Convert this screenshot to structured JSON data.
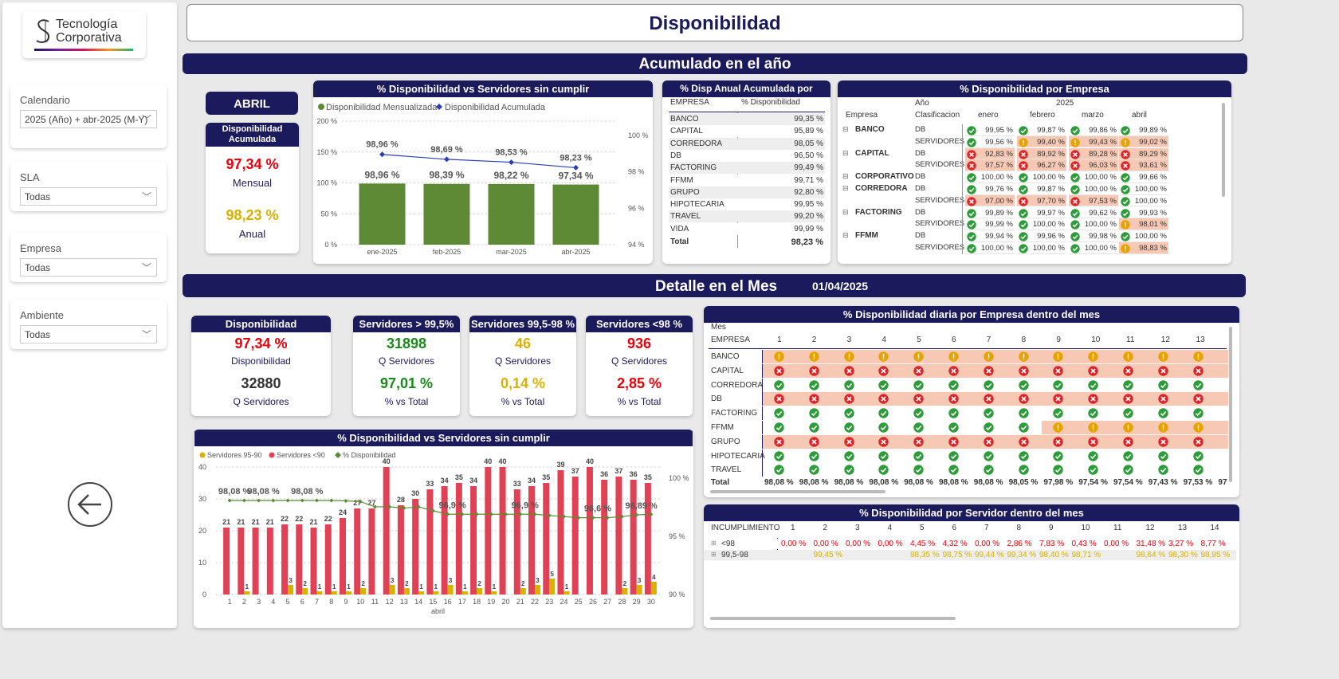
{
  "logo": {
    "line1": "Tecnología",
    "line2": "Corporativa"
  },
  "filters": [
    {
      "label": "Calendario",
      "value": "2025 (Año) + abr-2025 (M-Y)"
    },
    {
      "label": "SLA",
      "value": "Todas"
    },
    {
      "label": "Empresa",
      "value": "Todas"
    },
    {
      "label": "Ambiente",
      "value": "Todas"
    }
  ],
  "title": "Disponibilidad",
  "section1": "Acumulado en el año",
  "section2": "Detalle en el Mes",
  "section2_date": "01/04/2025",
  "month_card": {
    "month": "ABRIL",
    "header": "Disponibilidad Acumulada",
    "mensual_value": "97,34 %",
    "mensual_label": "Mensual",
    "anual_value": "98,23 %",
    "anual_label": "Anual"
  },
  "chart1": {
    "title": "% Disponibilidad vs Servidores sin cumplir",
    "legend": [
      "Disponibilidad Mensualizada",
      "Disponibilidad Acumulada"
    ]
  },
  "annual_table": {
    "title": "% Disp Anual Acumulada por Empresa",
    "col1": "EMPRESA",
    "col2": "% Disponibilidad",
    "rows": [
      [
        "BANCO",
        "99,35 %"
      ],
      [
        "CAPITAL",
        "95,89 %"
      ],
      [
        "CORREDORA",
        "98,05 %"
      ],
      [
        "DB",
        "96,50 %"
      ],
      [
        "FACTORING",
        "99,49 %"
      ],
      [
        "FFMM",
        "99,71 %"
      ],
      [
        "GRUPO",
        "92,80 %"
      ],
      [
        "HIPOTECARIA",
        "99,95 %"
      ],
      [
        "TRAVEL",
        "99,20 %"
      ],
      [
        "VIDA",
        "99,99 %"
      ]
    ],
    "total_label": "Total",
    "total_value": "98,23 %"
  },
  "matrix": {
    "title": "% Disponibilidad por Empresa",
    "year_label": "Año",
    "year": "2025",
    "col_empresa": "Empresa",
    "col_clasif": "Clasificacion",
    "months": [
      "enero",
      "febrero",
      "marzo",
      "abril"
    ],
    "rows": [
      {
        "empresa": "BANCO",
        "clas": "DB",
        "v": [
          [
            "99,95 %",
            "ok"
          ],
          [
            "99,87 %",
            "ok"
          ],
          [
            "99,86 %",
            "ok"
          ],
          [
            "99,89 %",
            "ok"
          ]
        ]
      },
      {
        "empresa": "",
        "clas": "SERVIDORES",
        "v": [
          [
            "99,56 %",
            "ok"
          ],
          [
            "99,40 %",
            "warn"
          ],
          [
            "99,43 %",
            "warn"
          ],
          [
            "99,02 %",
            "warn"
          ]
        ]
      },
      {
        "empresa": "CAPITAL",
        "clas": "DB",
        "v": [
          [
            "92,83 %",
            "bad"
          ],
          [
            "89,92 %",
            "bad"
          ],
          [
            "89,28 %",
            "bad"
          ],
          [
            "89,29 %",
            "bad"
          ]
        ]
      },
      {
        "empresa": "",
        "clas": "SERVIDORES",
        "v": [
          [
            "97,57 %",
            "bad"
          ],
          [
            "96,27 %",
            "bad"
          ],
          [
            "96,03 %",
            "bad"
          ],
          [
            "93,61 %",
            "bad"
          ]
        ]
      },
      {
        "empresa": "CORPORATIVO",
        "clas": "DB",
        "v": [
          [
            "100,00 %",
            "ok"
          ],
          [
            "100,00 %",
            "ok"
          ],
          [
            "100,00 %",
            "ok"
          ],
          [
            "99,66 %",
            "ok"
          ]
        ]
      },
      {
        "empresa": "CORREDORA",
        "clas": "DB",
        "v": [
          [
            "99,76 %",
            "ok"
          ],
          [
            "99,87 %",
            "ok"
          ],
          [
            "100,00 %",
            "ok"
          ],
          [
            "100,00 %",
            "ok"
          ]
        ]
      },
      {
        "empresa": "",
        "clas": "SERVIDORES",
        "v": [
          [
            "97,00 %",
            "bad"
          ],
          [
            "97,70 %",
            "bad"
          ],
          [
            "97,53 %",
            "bad"
          ],
          [
            "100,00 %",
            "ok"
          ]
        ]
      },
      {
        "empresa": "FACTORING",
        "clas": "DB",
        "v": [
          [
            "99,89 %",
            "ok"
          ],
          [
            "99,97 %",
            "ok"
          ],
          [
            "99,62 %",
            "ok"
          ],
          [
            "99,93 %",
            "ok"
          ]
        ]
      },
      {
        "empresa": "",
        "clas": "SERVIDORES",
        "v": [
          [
            "99,99 %",
            "ok"
          ],
          [
            "100,00 %",
            "ok"
          ],
          [
            "100,00 %",
            "ok"
          ],
          [
            "98,01 %",
            "warn"
          ]
        ]
      },
      {
        "empresa": "FFMM",
        "clas": "DB",
        "v": [
          [
            "99,94 %",
            "ok"
          ],
          [
            "99,96 %",
            "ok"
          ],
          [
            "99,98 %",
            "ok"
          ],
          [
            "100,00 %",
            "ok"
          ]
        ]
      },
      {
        "empresa": "",
        "clas": "SERVIDORES",
        "v": [
          [
            "100,00 %",
            "ok"
          ],
          [
            "100,00 %",
            "ok"
          ],
          [
            "100,00 %",
            "ok"
          ],
          [
            "98,83 %",
            "warn"
          ]
        ]
      }
    ]
  },
  "kpis": [
    {
      "header": "Disponibilidad",
      "v1": "97,34 %",
      "l1": "Disponibilidad",
      "v2": "32880",
      "l2": "Q Servidores",
      "c1": "#e8000b",
      "c2": "#333333"
    },
    {
      "header": "Servidores > 99,5%",
      "v1": "31898",
      "l1": "Q Servidores",
      "v2": "97,01 %",
      "l2": "% vs Total",
      "c1": "#178a17",
      "c2": "#178a17"
    },
    {
      "header": "Servidores 99,5-98 %",
      "v1": "46",
      "l1": "Q Servidores",
      "v2": "0,14 %",
      "l2": "% vs Total",
      "c1": "#d9b100",
      "c2": "#d9b100"
    },
    {
      "header": "Servidores <98 %",
      "v1": "936",
      "l1": "Q Servidores",
      "v2": "2,85 %",
      "l2": "% vs Total",
      "c1": "#e8000b",
      "c2": "#e8000b"
    }
  ],
  "chart2": {
    "title": "% Disponibilidad vs Servidores sin cumplir",
    "legend": [
      "Servidores 95-90",
      "Servidores <90",
      "% Disponibilidad"
    ]
  },
  "daily": {
    "title": "% Disponibilidad diaria por Empresa dentro del mes",
    "mes_label": "Mes",
    "col_empresa": "EMPRESA",
    "days": [
      "1",
      "2",
      "3",
      "4",
      "5",
      "6",
      "7",
      "8",
      "9",
      "10",
      "11",
      "12",
      "13"
    ],
    "rows": [
      {
        "name": "BANCO",
        "s": "wwwwwwwwwwwww",
        "bg": "#f7c9b4"
      },
      {
        "name": "CAPITAL",
        "s": "bbbbbbbbbbbbb",
        "bg": "#f7c9b4"
      },
      {
        "name": "CORREDORA",
        "s": "ooooooooooooo",
        "bg": ""
      },
      {
        "name": "DB",
        "s": "bbbbbbbbbbbbb",
        "bg": "#f7c9b4"
      },
      {
        "name": "FACTORING",
        "s": "ooooooooooooo",
        "bg": ""
      },
      {
        "name": "FFMM",
        "s": "oooooooowwwww",
        "bg": "mix"
      },
      {
        "name": "GRUPO",
        "s": "bbbbbbbbbbbbb",
        "bg": "#f7c9b4"
      },
      {
        "name": "HIPOTECARIA",
        "s": "ooooooooooooo",
        "bg": ""
      },
      {
        "name": "TRAVEL",
        "s": "ooooooooooooo",
        "bg": ""
      }
    ],
    "total_label": "Total",
    "totals": [
      "98,08 %",
      "98,08 %",
      "98,08 %",
      "98,08 %",
      "98,08 %",
      "98,08 %",
      "98,08 %",
      "98,05 %",
      "97,98 %",
      "97,54 %",
      "97,54 %",
      "97,43 %",
      "97,53 %",
      "97"
    ]
  },
  "server_table": {
    "title": "% Disponibilidad por Servidor dentro del mes",
    "col": "INCUMPLIMIENTO",
    "days": [
      "1",
      "2",
      "3",
      "4",
      "5",
      "6",
      "7",
      "8",
      "9",
      "10",
      "11",
      "12",
      "13",
      "14"
    ],
    "rows": [
      {
        "name": "<98",
        "color": "#e8000b",
        "v": [
          "0,00 %",
          "0,00 %",
          "0,00 %",
          "0,00 %",
          "4,45 %",
          "4,32 %",
          "0,00 %",
          "2,86 %",
          "7,83 %",
          "0,43 %",
          "0,00 %",
          "31,48 %",
          "3,27 %",
          "8,77 %"
        ]
      },
      {
        "name": "99,5-98",
        "color": "#d9b100",
        "v": [
          "",
          "99,45 %",
          "",
          "",
          "98,35 %",
          "98,75 %",
          "99,44 %",
          "99,34 %",
          "98,40 %",
          "98,71 %",
          "",
          "98,64 %",
          "98,30 %",
          "98,95 %"
        ]
      }
    ]
  },
  "chart_data": [
    {
      "type": "bar",
      "title": "% Disponibilidad vs Servidores sin cumplir",
      "categories": [
        "ene-2025",
        "feb-2025",
        "mar-2025",
        "abr-2025"
      ],
      "series": [
        {
          "name": "Disponibilidad Mensualizada",
          "values": [
            98.96,
            98.39,
            98.22,
            97.34
          ],
          "labels": [
            "98,96 %",
            "98,39 %",
            "98,22 %",
            "97,34 %"
          ],
          "color": "#5e8a35"
        },
        {
          "name": "Disponibilidad Acumulada",
          "values": [
            98.96,
            98.69,
            98.53,
            98.23
          ],
          "labels": [
            "98,96 %",
            "98,69 %",
            "98,53 %",
            "98,23 %"
          ],
          "color": "#2a3fb5"
        }
      ],
      "yticks_left": [
        "0 %",
        "50 %",
        "100 %",
        "150 %",
        "200 %"
      ],
      "yticks_right": [
        "94 %",
        "96 %",
        "98 %",
        "100 %"
      ]
    },
    {
      "type": "bar",
      "title": "% Disponibilidad vs Servidores sin cumplir",
      "xlabel": "abril",
      "categories": [
        "1",
        "2",
        "3",
        "4",
        "5",
        "6",
        "7",
        "8",
        "9",
        "10",
        "11",
        "12",
        "13",
        "14",
        "15",
        "16",
        "17",
        "18",
        "19",
        "20",
        "21",
        "22",
        "23",
        "24",
        "25",
        "26",
        "27",
        "28",
        "29",
        "30"
      ],
      "series": [
        {
          "name": "Servidores 95-90",
          "color": "#d9b100",
          "values": [
            0,
            1,
            0,
            0,
            3,
            2,
            1,
            1,
            1,
            2,
            0,
            3,
            2,
            1,
            1,
            3,
            1,
            2,
            1,
            0,
            2,
            3,
            5,
            1,
            0,
            0,
            0,
            2,
            3,
            4
          ]
        },
        {
          "name": "Servidores <90",
          "color": "#e04155",
          "values": [
            21,
            21,
            21,
            21,
            22,
            22,
            21,
            22,
            24,
            27,
            27,
            40,
            28,
            30,
            33,
            34,
            35,
            34,
            40,
            40,
            33,
            34,
            35,
            39,
            37,
            40,
            36,
            37,
            36,
            35
          ]
        },
        {
          "name": "% Disponibilidad",
          "color": "#5e8a35",
          "values": [
            98.08,
            98.08,
            98.08,
            98.08,
            98.08,
            98.08,
            98.08,
            98.08,
            98.05,
            97.98,
            97.54,
            97.54,
            97.43,
            97.53,
            97.2,
            96.9,
            96.9,
            96.9,
            96.9,
            96.9,
            96.9,
            96.9,
            96.8,
            96.7,
            96.6,
            96.6,
            96.6,
            96.7,
            96.85,
            96.89
          ]
        }
      ],
      "point_labels": [
        [
          0,
          "98,08 %"
        ],
        [
          2,
          "98,08 %"
        ],
        [
          5,
          "98,08 %"
        ],
        [
          15,
          "96,9 %"
        ],
        [
          20,
          "96,9 %"
        ],
        [
          25,
          "96,6 %"
        ],
        [
          28,
          "96,89 %"
        ]
      ],
      "yticks_left": [
        "0",
        "10",
        "20",
        "30",
        "40"
      ],
      "yticks_right": [
        "90 %",
        "95 %",
        "100 %"
      ]
    }
  ]
}
